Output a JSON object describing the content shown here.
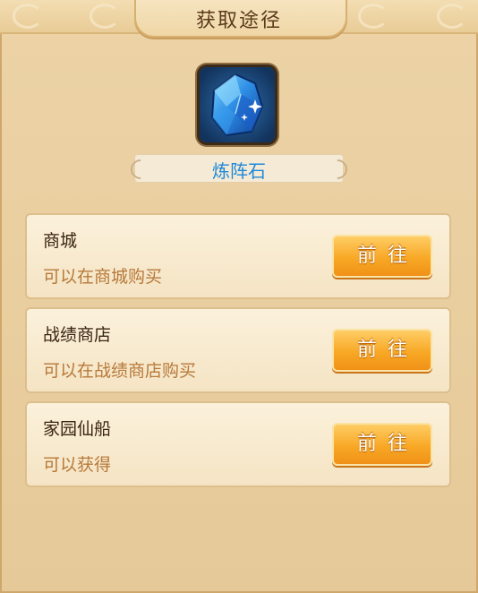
{
  "dialog": {
    "title": "获取途径"
  },
  "item": {
    "name": "炼阵石",
    "icon": "blue-crystal-icon"
  },
  "sources": [
    {
      "title": "商城",
      "description": "可以在商城购买",
      "button_label": "前往"
    },
    {
      "title": "战绩商店",
      "description": "可以在战绩商店购买",
      "button_label": "前往"
    },
    {
      "title": "家园仙船",
      "description": "可以获得",
      "button_label": "前往"
    }
  ],
  "colors": {
    "item_name": "#1e88d8",
    "button": "#f8a825",
    "description": "#b7793a"
  }
}
